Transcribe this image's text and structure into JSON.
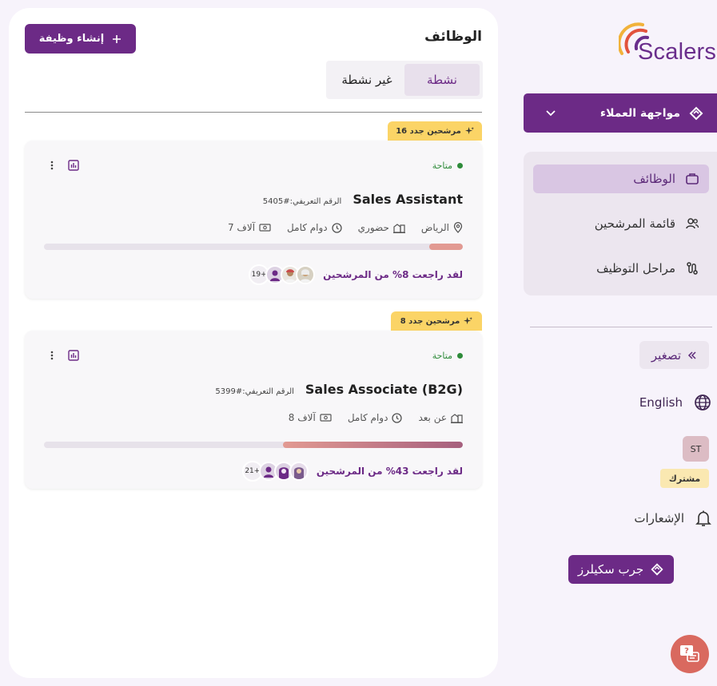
{
  "brand": {
    "name": "Scalers"
  },
  "sidebar": {
    "workspace_label": "مواجهة العملاء",
    "items": [
      {
        "label": "الوظائف",
        "icon": "briefcase-icon",
        "active": true
      },
      {
        "label": "قائمة المرشحين",
        "icon": "users-icon",
        "active": false
      },
      {
        "label": "مراحل التوظيف",
        "icon": "pipeline-icon",
        "active": false
      }
    ],
    "collapse_label": "تصغير",
    "language_label": "English",
    "user_initials": "ST",
    "subscription_badge": "مشترك",
    "notifications_label": "الإشعارات",
    "try_label": "جرب سكيلرز"
  },
  "main": {
    "title": "الوظائف",
    "create_label": "إنشاء وظيفة",
    "tabs": [
      {
        "label": "نشطة",
        "active": true
      },
      {
        "label": "غير نشطة",
        "active": false
      }
    ]
  },
  "jobs": [
    {
      "new_badge": "16 مرشحين جدد",
      "status": "متاحة",
      "title": "Sales Assistant",
      "id_text": "الرقم التعريفي:#5405",
      "location": "الرياض",
      "work_mode": "حضوري",
      "employment": "دوام كامل",
      "salary": "7 آلاف",
      "reviewed_percent": 8,
      "review_text": "لقد راجعت 8% من المرشحين",
      "more_count": "19+"
    },
    {
      "new_badge": "8 مرشحين جدد",
      "status": "متاحة",
      "title": "Sales Associate (B2G)",
      "id_text": "الرقم التعريفي:#5399",
      "work_mode": "عن بعد",
      "employment": "دوام كامل",
      "salary": "8 آلاف",
      "reviewed_percent": 43,
      "review_text": "لقد راجعت 43% من المرشحين",
      "more_count": "21+"
    }
  ],
  "colors": {
    "primary": "#6c2a86",
    "badge_yellow": "#fbd466",
    "status_green": "#2e8b3a",
    "progress_start": "#e29a92",
    "progress_end": "#a6607e",
    "chat_fab": "#d9695f"
  }
}
